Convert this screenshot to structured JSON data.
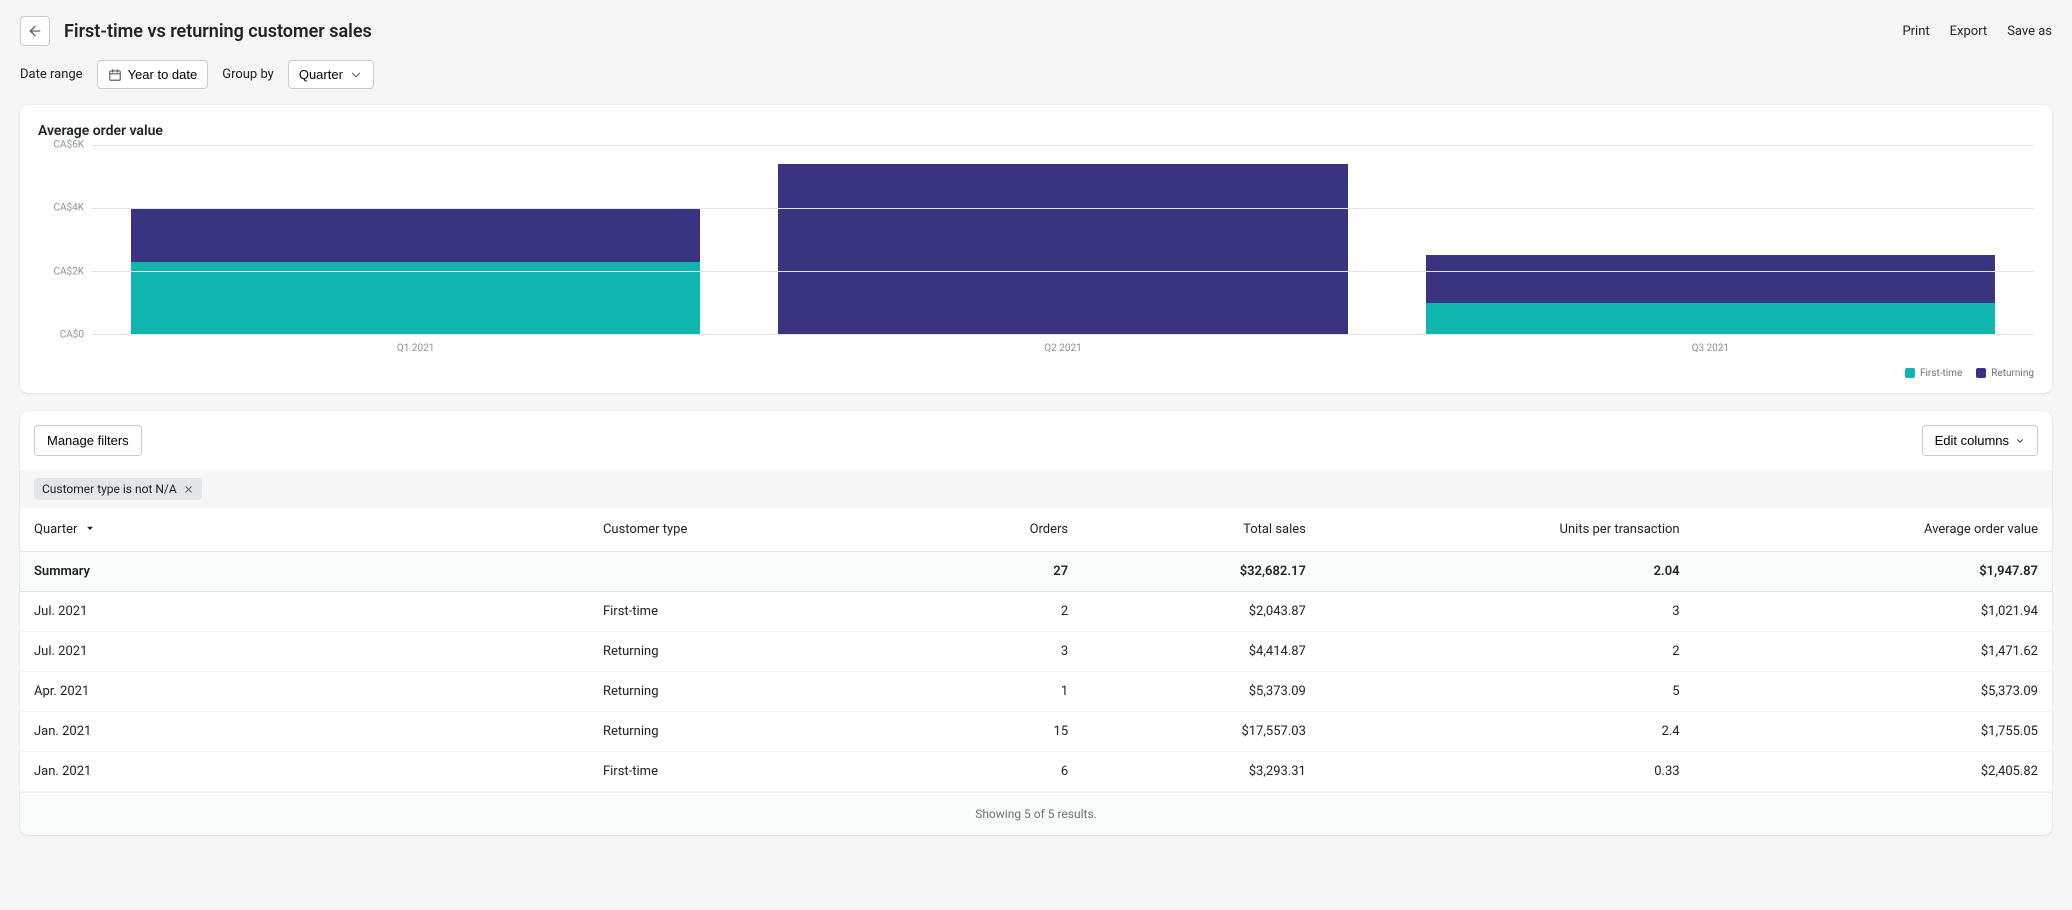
{
  "header": {
    "title": "First-time vs returning customer sales",
    "actions": {
      "print": "Print",
      "export": "Export",
      "save_as": "Save as"
    }
  },
  "controls": {
    "date_range_label": "Date range",
    "date_range_value": "Year to date",
    "group_by_label": "Group by",
    "group_by_value": "Quarter"
  },
  "chart": {
    "title": "Average order value",
    "legend": {
      "first": "First-time",
      "returning": "Returning"
    },
    "colors": {
      "first": "#0fb5ae",
      "returning": "#3a337f"
    }
  },
  "chart_data": {
    "type": "bar",
    "stacked": true,
    "title": "Average order value",
    "ylabel": "",
    "xlabel": "",
    "ylim": [
      0,
      6000
    ],
    "y_ticks": [
      "CA$6K",
      "CA$4K",
      "CA$2K",
      "CA$0"
    ],
    "categories": [
      "Q1 2021",
      "Q2 2021",
      "Q3 2021"
    ],
    "series": [
      {
        "name": "First-time",
        "values": [
          2300,
          0,
          1000
        ]
      },
      {
        "name": "Returning",
        "values": [
          1700,
          5400,
          1500
        ]
      }
    ]
  },
  "table": {
    "toolbar": {
      "manage_filters": "Manage filters",
      "edit_columns": "Edit columns"
    },
    "filter_tag": "Customer type is not N/A",
    "columns": {
      "period": "Quarter",
      "type": "Customer type",
      "orders": "Orders",
      "total_sales": "Total sales",
      "upt": "Units per transaction",
      "aov": "Average order value"
    },
    "summary": {
      "label": "Summary",
      "orders": "27",
      "total_sales": "$32,682.17",
      "upt": "2.04",
      "aov": "$1,947.87"
    },
    "rows": [
      {
        "period": "Jul. 2021",
        "type": "First-time",
        "orders": "2",
        "total_sales": "$2,043.87",
        "upt": "3",
        "aov": "$1,021.94"
      },
      {
        "period": "Jul. 2021",
        "type": "Returning",
        "orders": "3",
        "total_sales": "$4,414.87",
        "upt": "2",
        "aov": "$1,471.62"
      },
      {
        "period": "Apr. 2021",
        "type": "Returning",
        "orders": "1",
        "total_sales": "$5,373.09",
        "upt": "5",
        "aov": "$5,373.09"
      },
      {
        "period": "Jan. 2021",
        "type": "Returning",
        "orders": "15",
        "total_sales": "$17,557.03",
        "upt": "2.4",
        "aov": "$1,755.05"
      },
      {
        "period": "Jan. 2021",
        "type": "First-time",
        "orders": "6",
        "total_sales": "$3,293.31",
        "upt": "0.33",
        "aov": "$2,405.82"
      }
    ],
    "footer": "Showing 5 of 5 results."
  }
}
